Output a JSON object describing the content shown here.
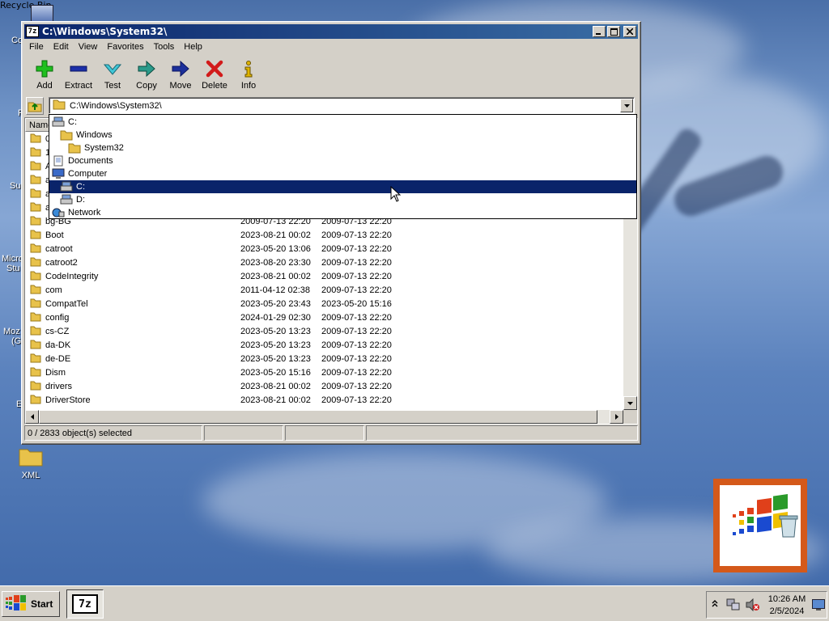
{
  "desktop": {
    "edge_labels": [
      "Co",
      "F",
      "Su",
      "Micro",
      "Stu",
      "Moz",
      "(G",
      "E"
    ],
    "xml_icon_label": "XML",
    "recycle_bin_label": "Recycle Bin"
  },
  "window": {
    "title": "C:\\Windows\\System32\\",
    "app_icon_text": "7z",
    "menu": [
      "File",
      "Edit",
      "View",
      "Favorites",
      "Tools",
      "Help"
    ],
    "toolbar": [
      {
        "label": "Add",
        "icon": "add-icon",
        "color": "#1a9c1a"
      },
      {
        "label": "Extract",
        "icon": "extract-icon",
        "color": "#1c2fa8"
      },
      {
        "label": "Test",
        "icon": "test-icon",
        "color": "#2aa4b0"
      },
      {
        "label": "Copy",
        "icon": "copy-icon",
        "color": "#1e7a6e"
      },
      {
        "label": "Move",
        "icon": "move-icon",
        "color": "#1c2f8a"
      },
      {
        "label": "Delete",
        "icon": "delete-icon",
        "color": "#d21a1a"
      },
      {
        "label": "Info",
        "icon": "info-icon",
        "color": "#c8a000"
      }
    ],
    "address": "C:\\Windows\\System32\\",
    "columns": {
      "name": "Name"
    },
    "rows": [
      {
        "name": "0-",
        "modified": "",
        "created": ""
      },
      {
        "name": "1(",
        "modified": "",
        "created": ""
      },
      {
        "name": "A",
        "modified": "",
        "created": ""
      },
      {
        "name": "a",
        "modified": "",
        "created": ""
      },
      {
        "name": "a",
        "modified": "",
        "created": ""
      },
      {
        "name": "a",
        "modified": "",
        "created": ""
      },
      {
        "name": "bg-BG",
        "modified": "2009-07-13 22:20",
        "created": "2009-07-13 22:20"
      },
      {
        "name": "Boot",
        "modified": "2023-08-21 00:02",
        "created": "2009-07-13 22:20"
      },
      {
        "name": "catroot",
        "modified": "2023-05-20 13:06",
        "created": "2009-07-13 22:20"
      },
      {
        "name": "catroot2",
        "modified": "2023-08-20 23:30",
        "created": "2009-07-13 22:20"
      },
      {
        "name": "CodeIntegrity",
        "modified": "2023-08-21 00:02",
        "created": "2009-07-13 22:20"
      },
      {
        "name": "com",
        "modified": "2011-04-12 02:38",
        "created": "2009-07-13 22:20"
      },
      {
        "name": "CompatTel",
        "modified": "2023-05-20 23:43",
        "created": "2023-05-20 15:16"
      },
      {
        "name": "config",
        "modified": "2024-01-29 02:30",
        "created": "2009-07-13 22:20"
      },
      {
        "name": "cs-CZ",
        "modified": "2023-05-20 13:23",
        "created": "2009-07-13 22:20"
      },
      {
        "name": "da-DK",
        "modified": "2023-05-20 13:23",
        "created": "2009-07-13 22:20"
      },
      {
        "name": "de-DE",
        "modified": "2023-05-20 13:23",
        "created": "2009-07-13 22:20"
      },
      {
        "name": "Dism",
        "modified": "2023-05-20 15:16",
        "created": "2009-07-13 22:20"
      },
      {
        "name": "drivers",
        "modified": "2023-08-21 00:02",
        "created": "2009-07-13 22:20"
      },
      {
        "name": "DriverStore",
        "modified": "2023-08-21 00:02",
        "created": "2009-07-13 22:20"
      }
    ],
    "status": "0 / 2833 object(s) selected"
  },
  "address_dropdown": {
    "items": [
      {
        "label": "C:",
        "icon": "drive-icon",
        "indent": 0,
        "selected": false
      },
      {
        "label": "Windows",
        "icon": "folder-icon",
        "indent": 1,
        "selected": false
      },
      {
        "label": "System32",
        "icon": "folder-icon",
        "indent": 2,
        "selected": false
      },
      {
        "label": "Documents",
        "icon": "documents-icon",
        "indent": 0,
        "selected": false
      },
      {
        "label": "Computer",
        "icon": "computer-icon",
        "indent": 0,
        "selected": false
      },
      {
        "label": "C:",
        "icon": "drive-icon",
        "indent": 1,
        "selected": true
      },
      {
        "label": "D:",
        "icon": "drive-icon",
        "indent": 1,
        "selected": false
      },
      {
        "label": "Network",
        "icon": "network-icon",
        "indent": 0,
        "selected": false
      }
    ]
  },
  "taskbar": {
    "start_label": "Start",
    "task_7z_text": "7z",
    "time": "10:26 AM",
    "date": "2/5/2024"
  },
  "colors": {
    "selection": "#0a246a",
    "titlebar_start": "#0a246a",
    "titlebar_end": "#3a6ea5",
    "folder": "#e8c24a",
    "recycle_frame": "#d4591a"
  }
}
